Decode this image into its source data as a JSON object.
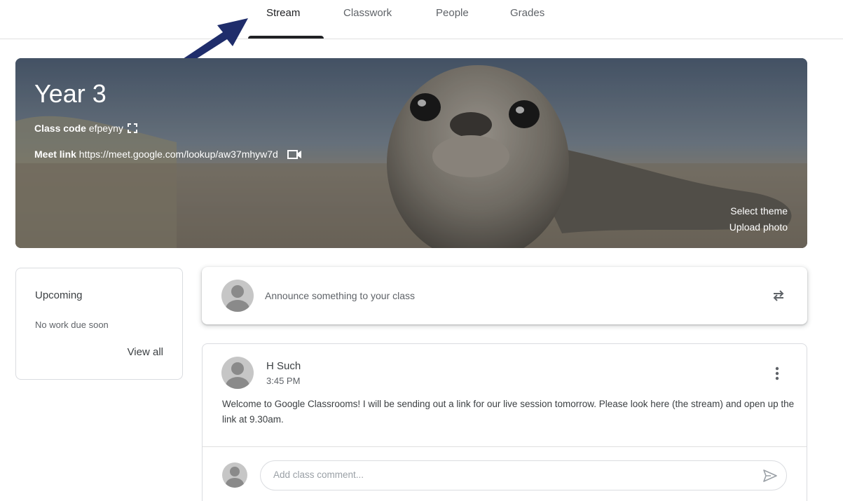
{
  "tabs": [
    {
      "label": "Stream",
      "active": true
    },
    {
      "label": "Classwork",
      "active": false
    },
    {
      "label": "People",
      "active": false
    },
    {
      "label": "Grades",
      "active": false
    }
  ],
  "banner": {
    "title": "Year 3",
    "class_code_label": "Class code",
    "class_code": "efpeyny",
    "meet_link_label": "Meet link",
    "meet_link": "https://meet.google.com/lookup/aw37mhyw7d",
    "select_theme": "Select theme",
    "upload_photo": "Upload photo"
  },
  "upcoming": {
    "title": "Upcoming",
    "empty_text": "No work due soon",
    "view_all": "View all"
  },
  "announce": {
    "placeholder": "Announce something to your class"
  },
  "post": {
    "author": "H Such",
    "time": "3:45 PM",
    "body": "Welcome to Google Classrooms! I will be sending out a link for our live session tomorrow. Please look here (the stream) and open up the link at 9.30am.",
    "comment_placeholder": "Add class comment..."
  },
  "colors": {
    "arrow": "#1f2d6b",
    "active_tab_underline": "#202124"
  }
}
